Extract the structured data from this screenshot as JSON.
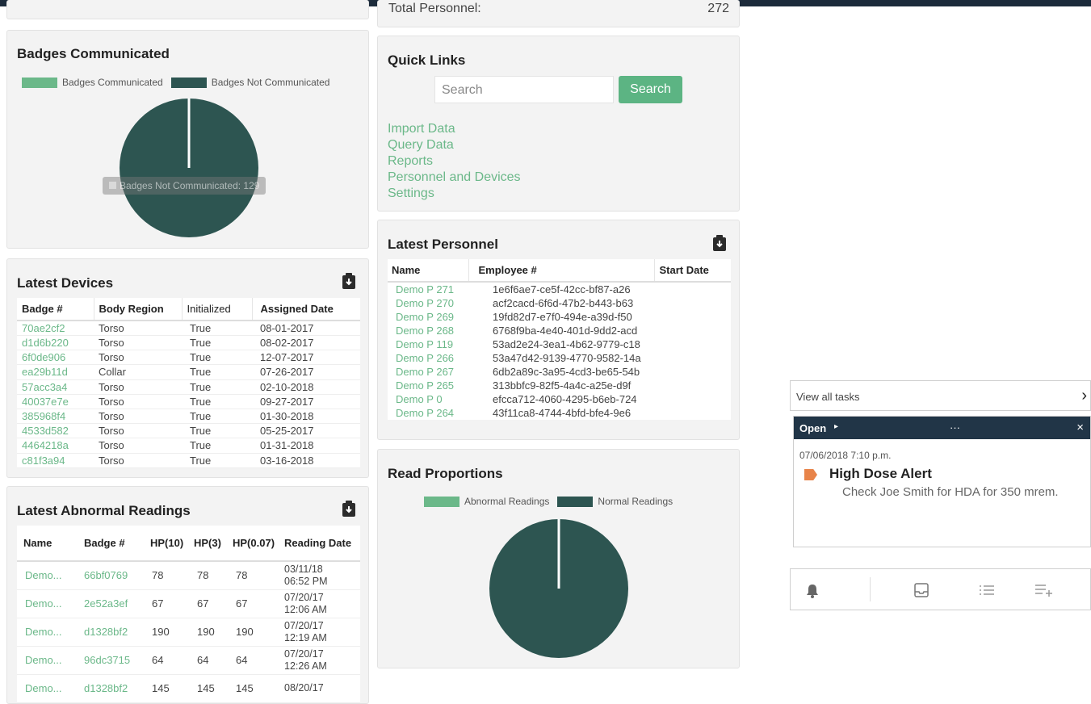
{
  "colors": {
    "green": "#6bb889",
    "dark_teal": "#2d5551",
    "navy": "#213547",
    "orange": "#e8844a"
  },
  "top_panel": {
    "label": "Total Personnel:",
    "value": "272"
  },
  "badges_communicated": {
    "title": "Badges Communicated",
    "legend": [
      "Badges Communicated",
      "Badges Not Communicated"
    ],
    "tooltip": "Badges Not Communicated: 129",
    "chart_data": {
      "type": "pie",
      "categories": [
        "Badges Communicated",
        "Badges Not Communicated"
      ],
      "values": [
        0,
        129
      ]
    }
  },
  "quick_links": {
    "title": "Quick Links",
    "search_placeholder": "Search",
    "search_button": "Search",
    "links": [
      "Import Data",
      "Query Data",
      "Reports",
      "Personnel and Devices",
      "Settings"
    ]
  },
  "latest_devices": {
    "title": "Latest Devices",
    "download_icon": "clipboard-download-icon",
    "columns": [
      "Badge #",
      "Body Region",
      "Initialized",
      "Assigned Date"
    ],
    "rows": [
      [
        "70ae2cf2",
        "Torso",
        "True",
        "08-01-2017"
      ],
      [
        "d1d6b220",
        "Torso",
        "True",
        "08-02-2017"
      ],
      [
        "6f0de906",
        "Torso",
        "True",
        "12-07-2017"
      ],
      [
        "ea29b11d",
        "Collar",
        "True",
        "07-26-2017"
      ],
      [
        "57acc3a4",
        "Torso",
        "True",
        "02-10-2018"
      ],
      [
        "40037e7e",
        "Torso",
        "True",
        "09-27-2017"
      ],
      [
        "385968f4",
        "Torso",
        "True",
        "01-30-2018"
      ],
      [
        "4533d582",
        "Torso",
        "True",
        "05-25-2017"
      ],
      [
        "4464218a",
        "Torso",
        "True",
        "01-31-2018"
      ],
      [
        "c81f3a94",
        "Torso",
        "True",
        "03-16-2018"
      ]
    ]
  },
  "latest_personnel": {
    "title": "Latest Personnel",
    "download_icon": "clipboard-download-icon",
    "columns": [
      "Name",
      "Employee #",
      "Start Date"
    ],
    "rows": [
      [
        "Demo P 271",
        "1e6f6ae7-ce5f-42cc-bf87-a26",
        ""
      ],
      [
        "Demo P 270",
        "acf2cacd-6f6d-47b2-b443-b63",
        ""
      ],
      [
        "Demo P 269",
        "19fd82d7-e7f0-494e-a39d-f50",
        ""
      ],
      [
        "Demo P 268",
        "6768f9ba-4e40-401d-9dd2-acd",
        ""
      ],
      [
        "Demo P 119",
        "53ad2e24-3ea1-4b62-9779-c18",
        ""
      ],
      [
        "Demo P 266",
        "53a47d42-9139-4770-9582-14a",
        ""
      ],
      [
        "Demo P 267",
        "6db2a89c-3a95-4cd3-be65-54b",
        ""
      ],
      [
        "Demo P 265",
        "313bbfc9-82f5-4a4c-a25e-d9f",
        ""
      ],
      [
        "Demo P 0",
        "efcca712-4060-4295-b6eb-724",
        ""
      ],
      [
        "Demo P 264",
        "43f11ca8-4744-4bfd-bfe4-9e6",
        ""
      ]
    ]
  },
  "latest_abnormal": {
    "title": "Latest Abnormal Readings",
    "download_icon": "clipboard-download-icon",
    "columns": [
      "Name",
      "Badge #",
      "HP(10)",
      "HP(3)",
      "HP(0.07)",
      "Reading Date"
    ],
    "rows": [
      [
        "Demo...",
        "66bf0769",
        "78",
        "78",
        "78",
        "03/11/18",
        "06:52 PM"
      ],
      [
        "Demo...",
        "2e52a3ef",
        "67",
        "67",
        "67",
        "07/20/17",
        "12:06 AM"
      ],
      [
        "Demo...",
        "d1328bf2",
        "190",
        "190",
        "190",
        "07/20/17",
        "12:19 AM"
      ],
      [
        "Demo...",
        "96dc3715",
        "64",
        "64",
        "64",
        "07/20/17",
        "12:26 AM"
      ],
      [
        "Demo...",
        "d1328bf2",
        "145",
        "145",
        "145",
        "08/20/17",
        ""
      ]
    ]
  },
  "read_proportions": {
    "title": "Read Proportions",
    "legend": [
      "Abnormal Readings",
      "Normal Readings"
    ],
    "chart_data": {
      "type": "pie",
      "categories": [
        "Abnormal Readings",
        "Normal Readings"
      ],
      "values": [
        0,
        1
      ]
    }
  },
  "tasks": {
    "view_all": "View all tasks",
    "status": "Open",
    "more": "···",
    "timestamp": "07/06/2018 7:10 p.m.",
    "alert_title": "High Dose Alert",
    "alert_body": "Check Joe Smith for HDA for 350 mrem.",
    "toolbar_icons": [
      "bell-icon",
      "inbox-icon",
      "list-icon",
      "add-list-icon"
    ]
  }
}
